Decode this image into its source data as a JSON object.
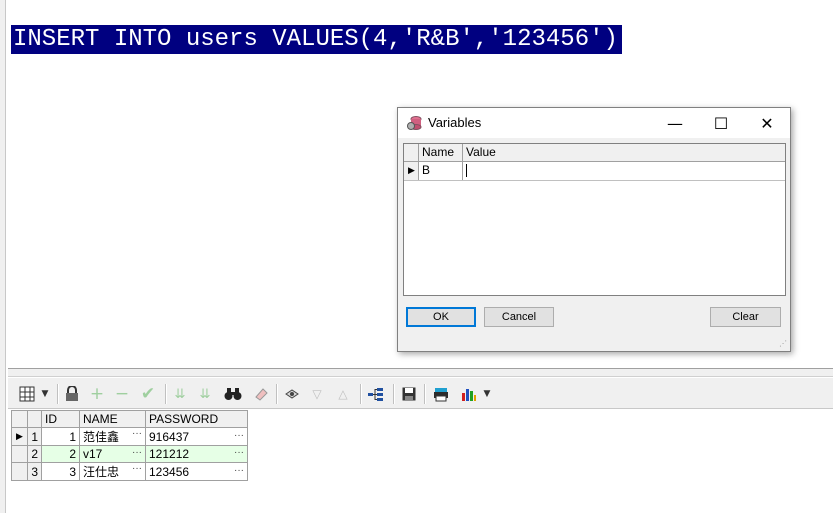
{
  "editor": {
    "sql": "INSERT INTO users VALUES(4,'R&B','123456')"
  },
  "toolbar": {
    "icons": [
      "grid-view-icon",
      "dropdown-arrow-icon",
      "lock-icon",
      "insert-record-icon",
      "delete-record-icon",
      "post-changes-icon",
      "fetch-next-icon",
      "fetch-last-icon",
      "find-icon",
      "clear-icon",
      "query-by-example-icon",
      "previous-icon",
      "next-icon",
      "explain-plan-icon",
      "save-icon",
      "print-icon",
      "chart-icon"
    ]
  },
  "grid": {
    "columns": [
      "ID",
      "NAME",
      "PASSWORD"
    ],
    "rows": [
      {
        "rownum": "1",
        "id": "1",
        "name": "范佳鑫",
        "password": "916437"
      },
      {
        "rownum": "2",
        "id": "2",
        "name": "v17",
        "password": "121212"
      },
      {
        "rownum": "3",
        "id": "3",
        "name": "汪仕忠",
        "password": "123456"
      }
    ],
    "ellipsis": "···"
  },
  "dialog": {
    "title": "Variables",
    "columns": {
      "name": "Name",
      "value": "Value"
    },
    "variable": {
      "name": "B",
      "value": ""
    },
    "buttons": {
      "ok": "OK",
      "cancel": "Cancel",
      "clear": "Clear"
    },
    "window_controls": {
      "minimize": "—",
      "maximize": "☐",
      "close": "✕"
    }
  }
}
